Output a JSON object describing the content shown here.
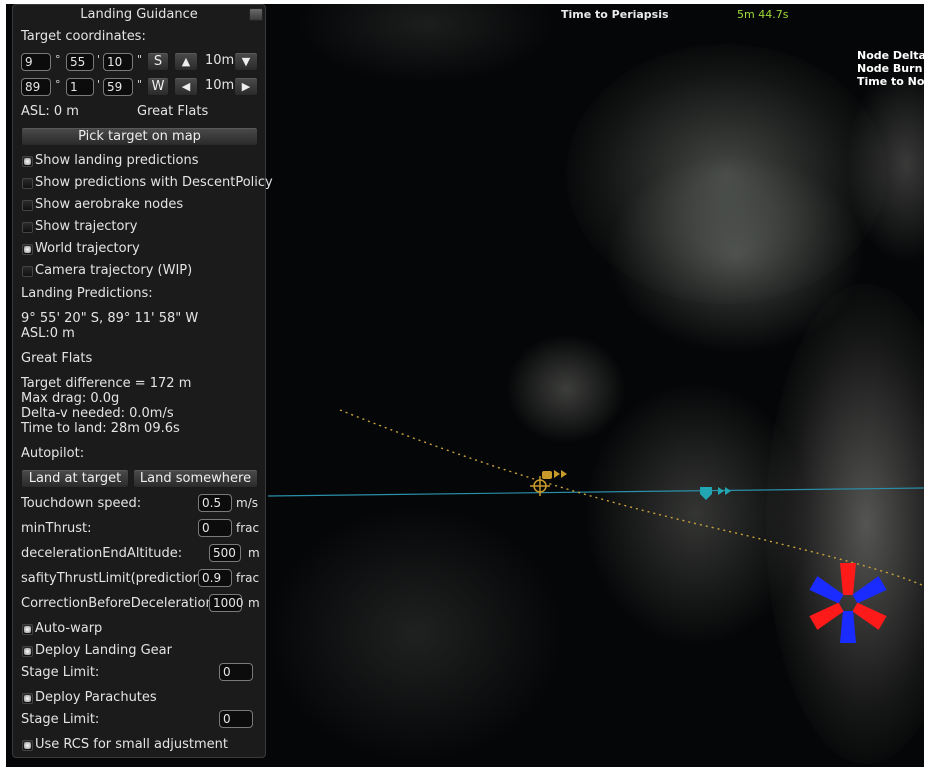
{
  "hud": {
    "time_to_periapsis_label": "Time to Periapsis",
    "time_to_periapsis_value": "5m 44.7s",
    "node_deltav_label": "Node DeltaV",
    "node_burn_label": "Node Burn T",
    "time_to_node_label": "Time to Node"
  },
  "panel": {
    "title": "Landing Guidance",
    "target_coordinates_label": "Target coordinates:",
    "lat": {
      "deg": "9",
      "min": "55",
      "sec": "10",
      "hemi": "S",
      "step": "10m"
    },
    "lon": {
      "deg": "89",
      "min": "1",
      "sec": "59",
      "hemi": "W",
      "step": "10m"
    },
    "symbols": {
      "deg": "°",
      "min": "'",
      "sec": "\""
    },
    "arrows": {
      "up": "▲",
      "down": "▼",
      "left": "◀",
      "right": "▶"
    },
    "asl": "ASL: 0 m",
    "biome": "Great Flats",
    "pick_target_label": "Pick target on map",
    "options": [
      {
        "label": "Show landing predictions",
        "on": true
      },
      {
        "label": "Show predictions with DescentPolicy",
        "on": false
      },
      {
        "label": "Show aerobrake nodes",
        "on": false
      },
      {
        "label": "Show trajectory",
        "on": false
      },
      {
        "label": "World trajectory",
        "on": true
      },
      {
        "label": "Camera trajectory (WIP)",
        "on": false
      }
    ],
    "predictions": {
      "header": "Landing Predictions:",
      "coords": "9° 55' 20\" S, 89° 11' 58\" W",
      "asl": "ASL:0 m",
      "biome": "Great Flats",
      "target_difference": "Target difference = 172 m",
      "max_drag": "Max drag: 0.0g",
      "delta_v": "Delta-v needed: 0.0m/s",
      "time_to_land": "Time to land: 28m 09.6s"
    },
    "autopilot": {
      "header": "Autopilot:",
      "land_at_target": "Land at target",
      "land_somewhere": "Land somewhere"
    },
    "params": [
      {
        "label": "Touchdown speed:",
        "value": "0.5",
        "unit": "m/s"
      },
      {
        "label": "minThrust:",
        "value": "0",
        "unit": "frac"
      },
      {
        "label": "decelerationEndAltitude:",
        "value": "500",
        "unit": "m"
      },
      {
        "label": "safityThrustLimit(prediction):",
        "value": "0.9",
        "unit": "frac"
      },
      {
        "label": "CorrectionBeforeDeceleration:",
        "value": "1000",
        "unit": "m"
      }
    ],
    "auto_warp": "Auto-warp",
    "deploy_gear": "Deploy Landing Gear",
    "gear_stage_label": "Stage Limit:",
    "gear_stage_value": "0",
    "deploy_chutes": "Deploy Parachutes",
    "chute_stage_label": "Stage Limit:",
    "chute_stage_value": "0",
    "use_rcs": "Use RCS for small adjustment"
  },
  "colors": {
    "panel_bg": "#1c1c1c",
    "hud_value": "#9fdc3a",
    "trajectory": "#c8a23a",
    "orbit_line": "#2a8fa8",
    "marker_red": "#ff1a1a",
    "marker_blue": "#1a2bff"
  }
}
